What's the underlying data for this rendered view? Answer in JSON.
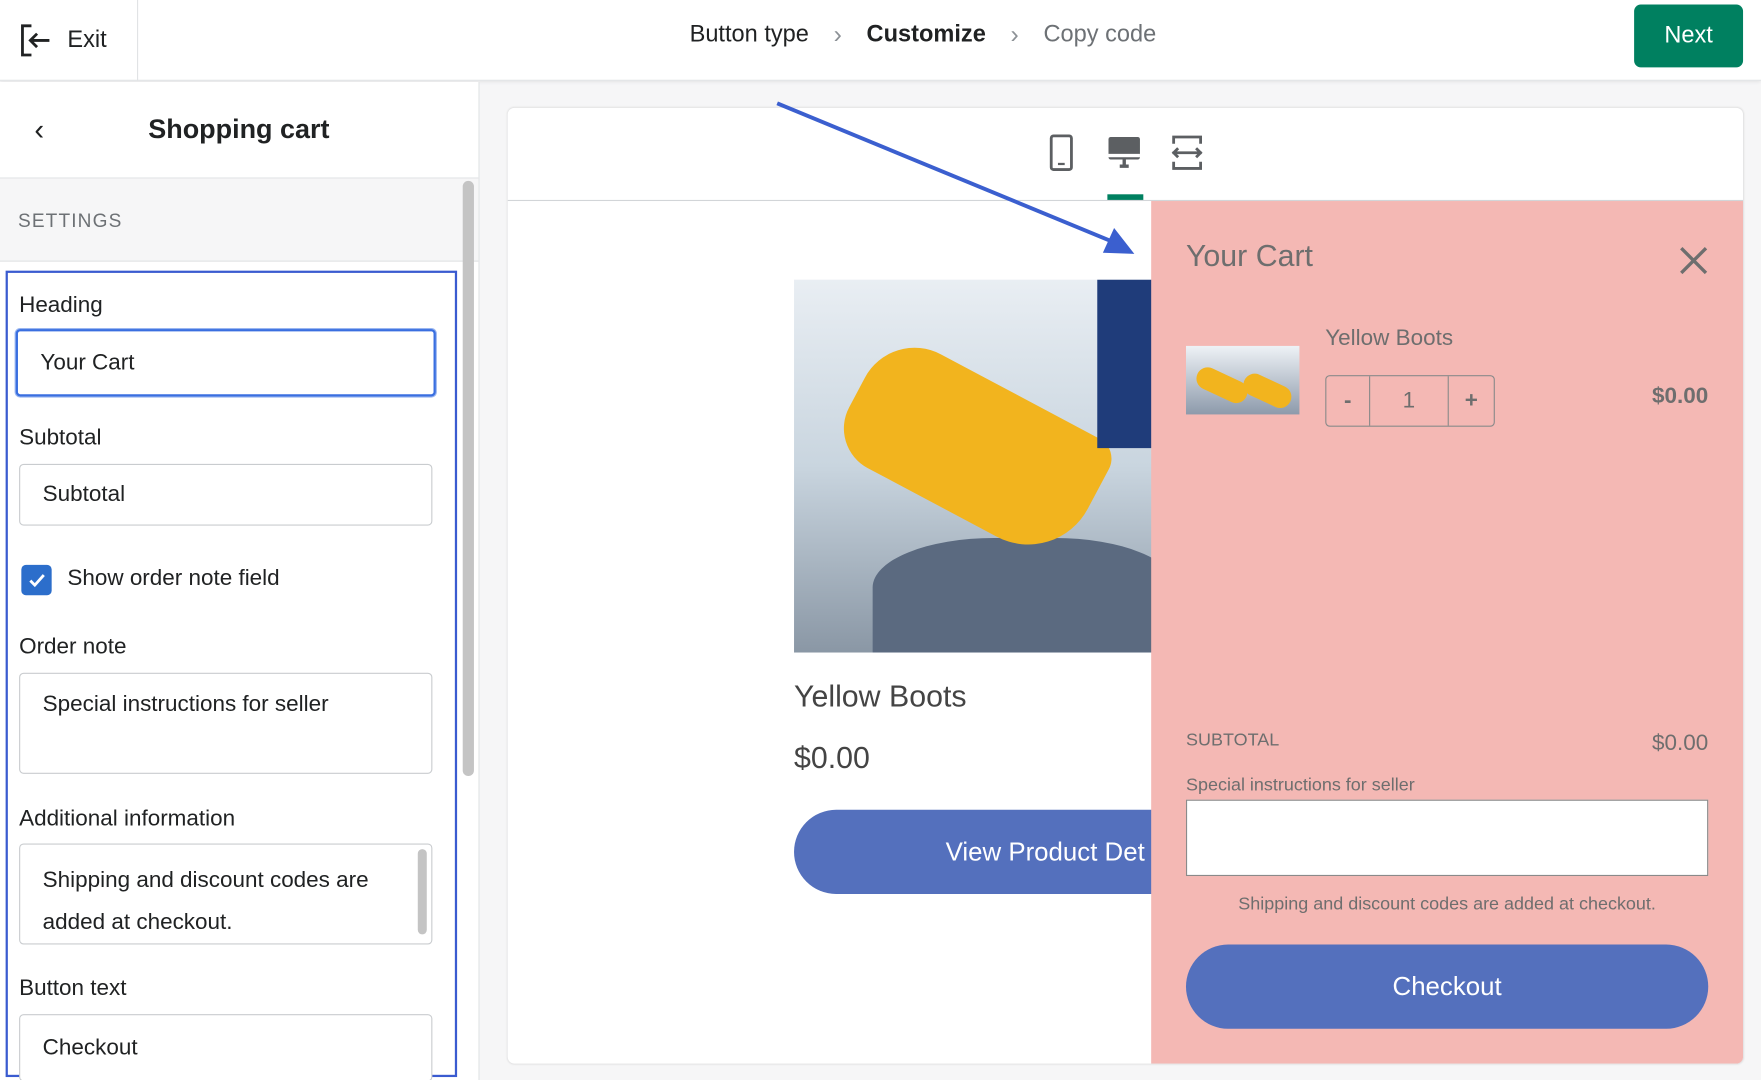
{
  "topbar": {
    "exit_label": "Exit",
    "breadcrumbs": [
      "Button type",
      "Customize",
      "Copy code"
    ],
    "next_label": "Next",
    "accent": "#008060"
  },
  "sidebar": {
    "title": "Shopping cart",
    "section": "SETTINGS",
    "heading_label": "Heading",
    "heading_value": "Your Cart",
    "subtotal_label": "Subtotal",
    "subtotal_value": "Subtotal",
    "show_note_label": "Show order note field",
    "show_note_checked": true,
    "order_note_label": "Order note",
    "order_note_value": "Special instructions for seller",
    "additional_label": "Additional information",
    "additional_value": "Shipping and discount codes are added at checkout.",
    "button_text_label": "Button text",
    "button_text_value": "Checkout"
  },
  "preview": {
    "devices": [
      "mobile-icon",
      "desktop-icon",
      "fullwidth-icon"
    ],
    "selected_device": "desktop",
    "product_title": "Yellow Boots",
    "product_price": "$0.00",
    "product_button": "View Product Det",
    "cart": {
      "heading": "Your Cart",
      "item_title": "Yellow Boots",
      "quantity": "1",
      "minus": "-",
      "plus": "+",
      "item_price": "$0.00",
      "subtotal_label": "SUBTOTAL",
      "subtotal_value": "$0.00",
      "note_label": "Special instructions for seller",
      "info": "Shipping and discount codes are added at checkout.",
      "checkout_label": "Checkout",
      "background": "#f4b8b4",
      "button_color": "#5470bd"
    }
  }
}
